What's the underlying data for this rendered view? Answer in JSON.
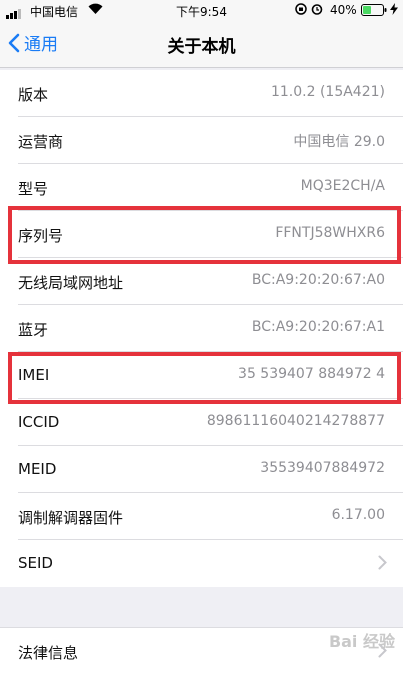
{
  "status": {
    "carrier": "中国电信",
    "time": "下午9:54",
    "battery": "40%"
  },
  "nav": {
    "back_label": "通用",
    "title": "关于本机"
  },
  "rows": [
    {
      "label": "版本",
      "value": "11.0.2 (15A421)"
    },
    {
      "label": "运营商",
      "value": "中国电信 29.0"
    },
    {
      "label": "型号",
      "value": "MQ3E2CH/A"
    },
    {
      "label": "序列号",
      "value": "FFNTJ58WHXR6"
    },
    {
      "label": "无线局域网地址",
      "value": "BC:A9:20:20:67:A0"
    },
    {
      "label": "蓝牙",
      "value": "BC:A9:20:20:67:A1"
    },
    {
      "label": "IMEI",
      "value": "35 539407 884972 4"
    },
    {
      "label": "ICCID",
      "value": "89861116040214278877"
    },
    {
      "label": "MEID",
      "value": "35539407884972"
    },
    {
      "label": "调制解调器固件",
      "value": "6.17.00"
    },
    {
      "label": "SEID",
      "value": ""
    }
  ],
  "legal": {
    "label": "法律信息"
  },
  "watermark": "Bai 经验",
  "colors": {
    "accent": "#1a7cf5",
    "highlight": "#e5323b",
    "battery": "#4cd964"
  }
}
